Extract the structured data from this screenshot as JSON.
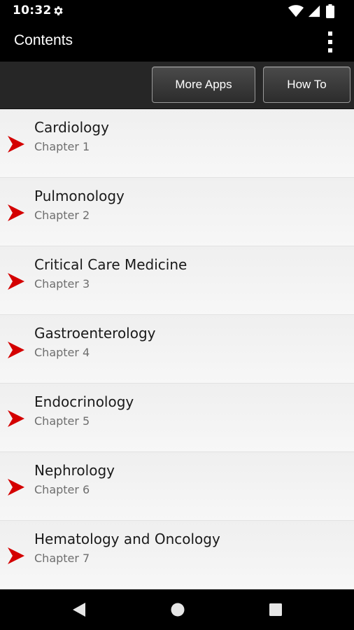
{
  "status_bar": {
    "time": "10:32"
  },
  "app_bar": {
    "title": "Contents"
  },
  "toolbar": {
    "more_apps_label": "More Apps",
    "how_to_label": "How To"
  },
  "colors": {
    "accent_arrow": "#d40000",
    "list_background": "#f5f5f5",
    "toolbar_background": "#262626"
  },
  "chapters": [
    {
      "title": "Cardiology",
      "subtitle": "Chapter 1"
    },
    {
      "title": "Pulmonology",
      "subtitle": "Chapter 2"
    },
    {
      "title": "Critical Care Medicine",
      "subtitle": "Chapter 3"
    },
    {
      "title": "Gastroenterology",
      "subtitle": "Chapter 4"
    },
    {
      "title": "Endocrinology",
      "subtitle": "Chapter 5"
    },
    {
      "title": "Nephrology",
      "subtitle": "Chapter 6"
    },
    {
      "title": "Hematology and Oncology",
      "subtitle": "Chapter 7"
    }
  ],
  "icons": {
    "status_settings": "gear-icon",
    "signal": "wifi-icon",
    "cellular": "cellular-signal-icon",
    "battery": "battery-icon",
    "menu": "overflow-menu-icon",
    "row_arrow": "chevron-right-icon",
    "back": "back-icon",
    "home": "home-icon",
    "recents": "recents-icon"
  }
}
